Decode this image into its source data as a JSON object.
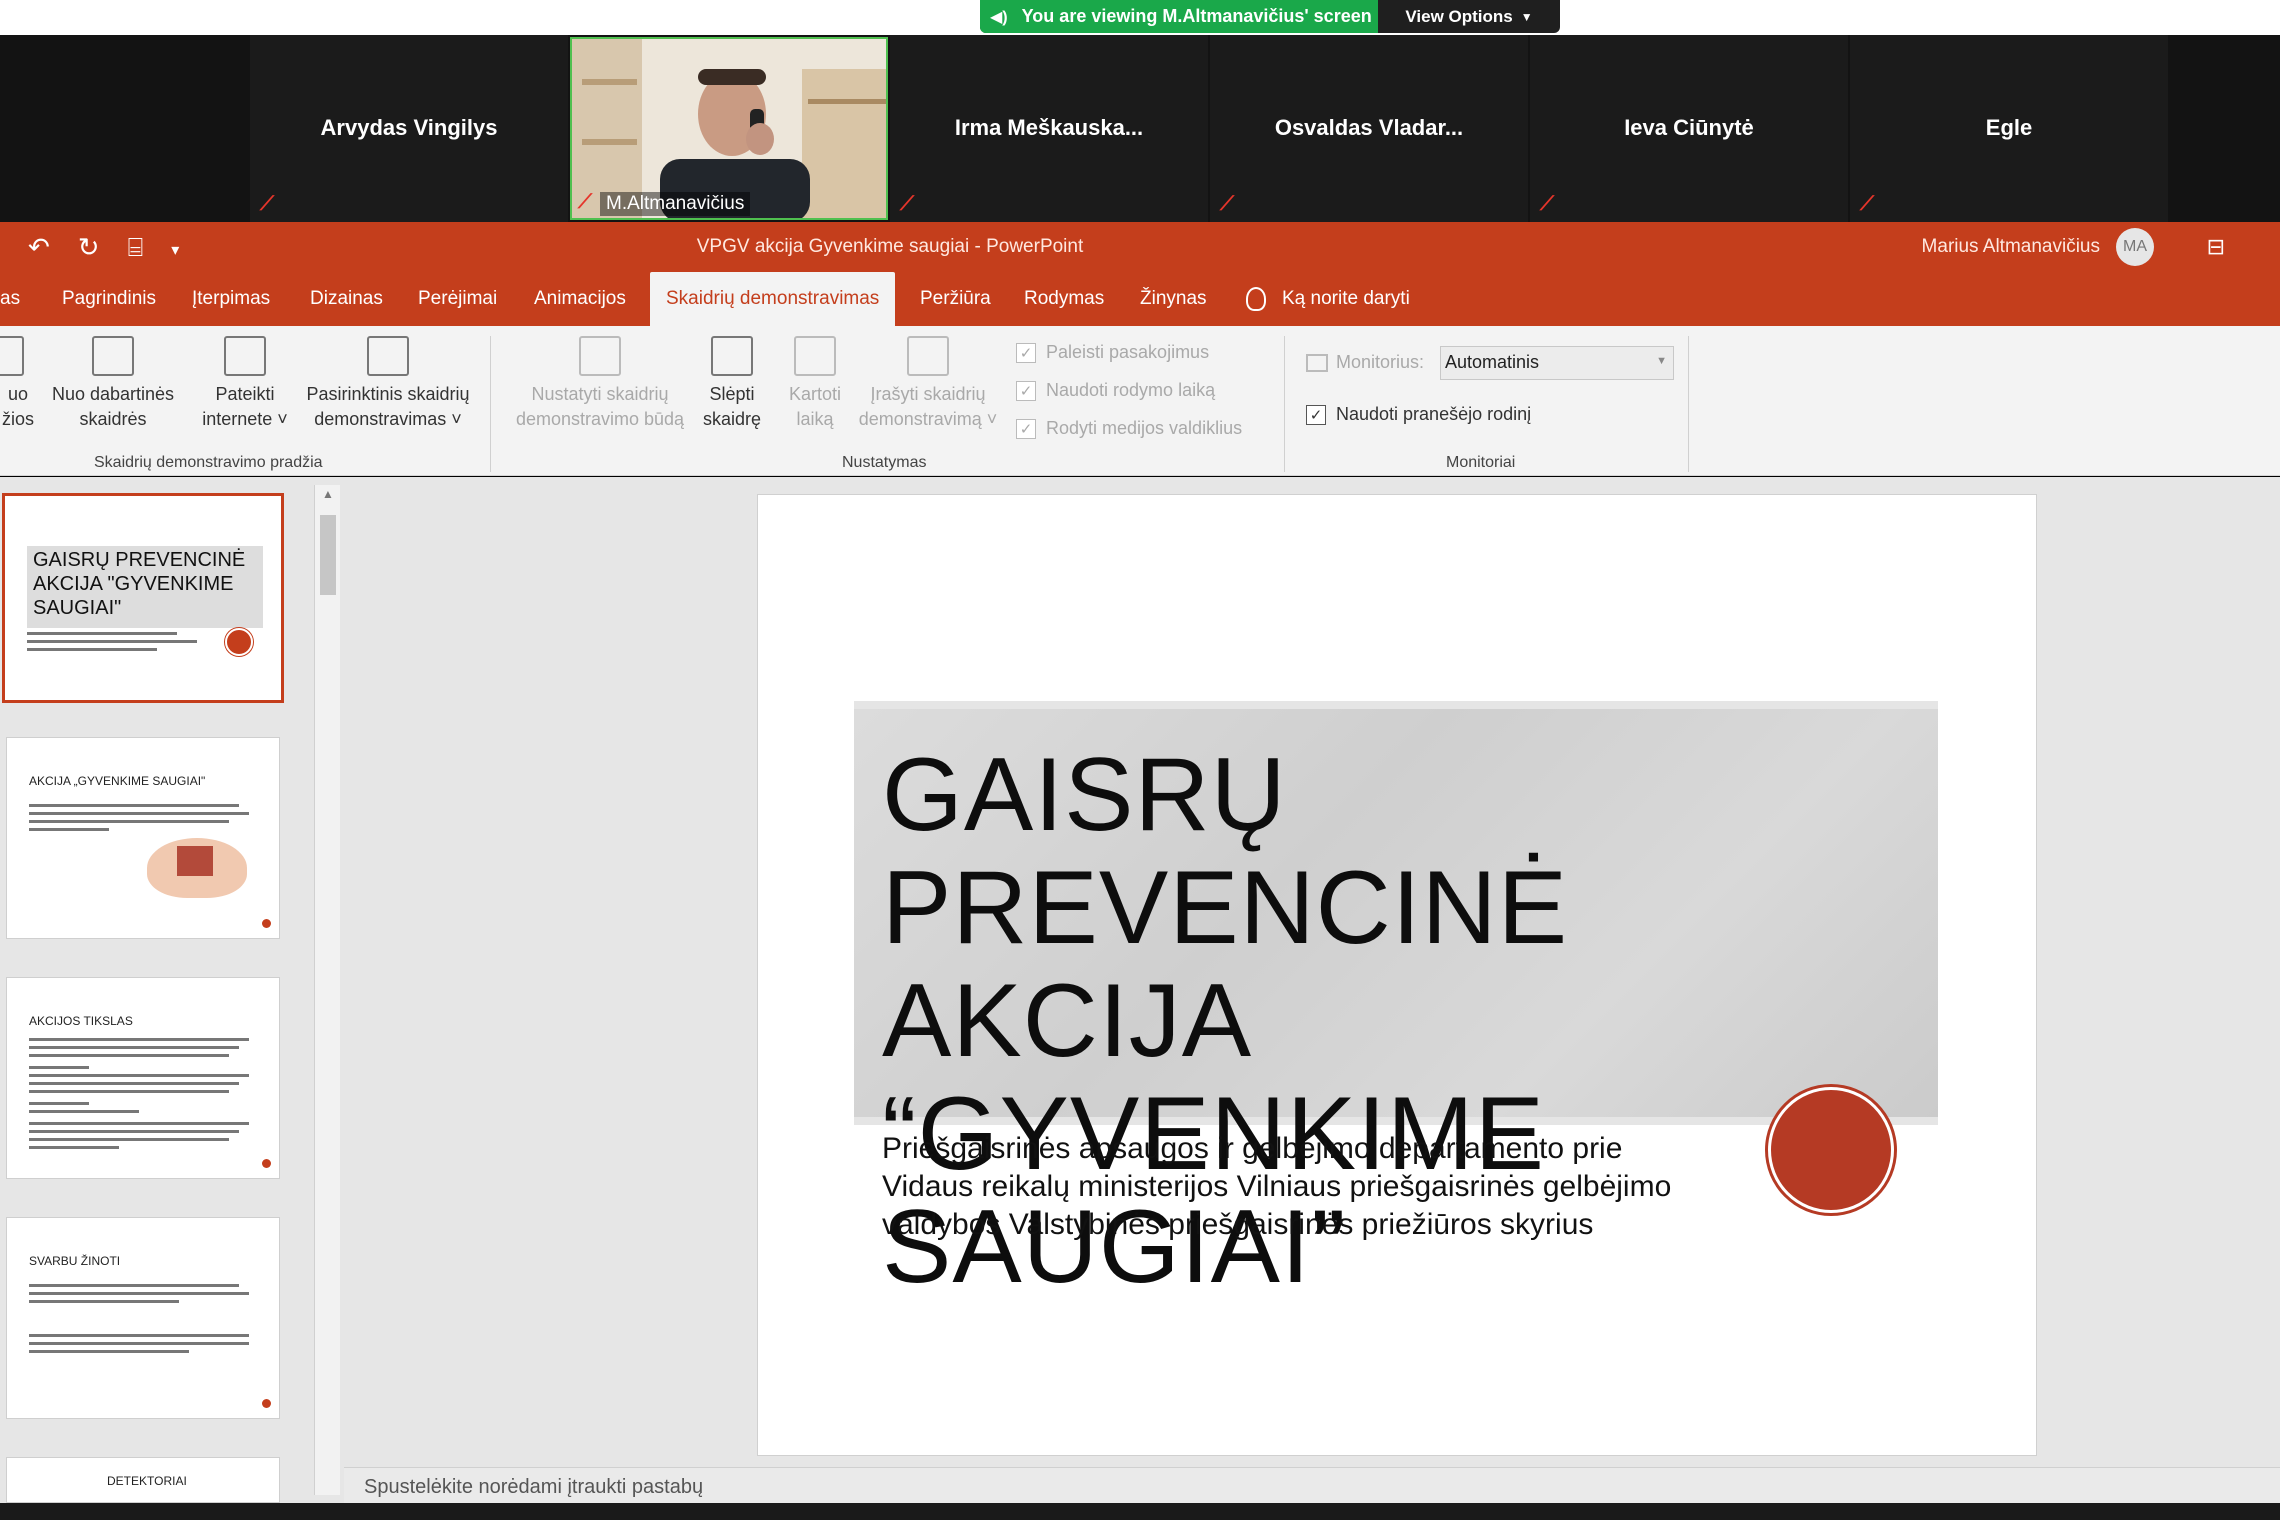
{
  "zoom": {
    "banner_text": "You are viewing M.Altmanavičius' screen",
    "view_options": "View Options",
    "participants": [
      {
        "name": "Arvydas Vingilys"
      },
      {
        "name": "M.Altmanavičius"
      },
      {
        "name": "Irma  Meškauska..."
      },
      {
        "name": "Osvaldas  Vladar..."
      },
      {
        "name": "Ieva Ciūnytė"
      },
      {
        "name": "Egle"
      }
    ]
  },
  "ppt": {
    "doc_title": "VPGV akcija Gyvenkime saugiai  -  PowerPoint",
    "user_name": "Marius Altmanavičius",
    "user_initials": "MA",
    "tabs": [
      "as",
      "Pagrindinis",
      "Įterpimas",
      "Dizainas",
      "Perėjimai",
      "Animacijos",
      "Skaidrių demonstravimas",
      "Peržiūra",
      "Rodymas",
      "Žinynas"
    ],
    "tell_me": "Ką norite daryti",
    "ribbon": {
      "start_group": {
        "label": "Skaidrių demonstravimo pradžia",
        "btn_from_start": [
          "uo",
          "žios"
        ],
        "btn_from_current": [
          "Nuo dabartinės",
          "skaidrės"
        ],
        "btn_online": [
          "Pateikti",
          "internete ˅"
        ],
        "btn_custom": [
          "Pasirinktinis skaidrių",
          "demonstravimas ˅"
        ]
      },
      "setup_group": {
        "label": "Nustatymas",
        "btn_setup": [
          "Nustatyti skaidrių",
          "demonstravimo būdą"
        ],
        "btn_hide": [
          "Slėpti",
          "skaidrę"
        ],
        "btn_rehearse": [
          "Kartoti",
          "laiką"
        ],
        "btn_record": [
          "Įrašyti skaidrių",
          "demonstravimą ˅"
        ],
        "chk_narration": "Paleisti pasakojimus",
        "chk_timings": "Naudoti rodymo laiką",
        "chk_media": "Rodyti medijos valdiklius"
      },
      "monitors_group": {
        "label": "Monitoriai",
        "monitor_label": "Monitorius:",
        "monitor_value": "Automatinis",
        "presenter_view": "Naudoti pranešėjo rodinį"
      }
    },
    "thumbnails": [
      {
        "title": "GAISRŲ PREVENCINĖ AKCIJA \"GYVENKIME SAUGIAI\""
      },
      {
        "title": "AKCIJA „GYVENKIME SAUGIAI\""
      },
      {
        "title": "AKCIJOS TIKSLAS"
      },
      {
        "title": "SVARBU ŽINOTI"
      },
      {
        "title": "DETEKTORIAI"
      }
    ],
    "slide": {
      "title": "GAISRŲ PREVENCINĖ AKCIJA “GYVENKIME SAUGIAI”",
      "subtitle": "Priešgaisrinės apsaugos ir gelbėjimo departamento prie Vidaus reikalų ministerijos Vilniaus priešgaisrinės gelbėjimo valdybos Valstybinės priešgaisrinės priežiūros skyrius"
    },
    "notes_placeholder": "Spustelėkite norėdami įtraukti pastabų"
  }
}
